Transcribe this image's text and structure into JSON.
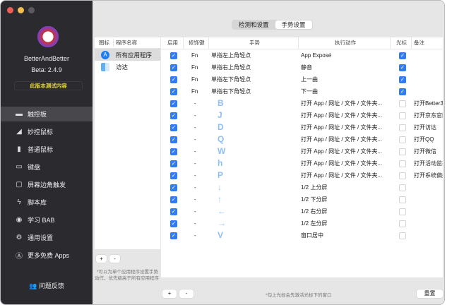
{
  "sidebar": {
    "app_name": "BetterAndBetter",
    "version": "Beta: 2.4.9",
    "test_content": "此版本测试内容",
    "items": [
      {
        "label": "触控板",
        "icon": "trackpad-icon"
      },
      {
        "label": "妙控鼠标",
        "icon": "magic-mouse-icon"
      },
      {
        "label": "普通鼠标",
        "icon": "mouse-icon"
      },
      {
        "label": "键盘",
        "icon": "keyboard-icon"
      },
      {
        "label": "屏幕边角触发",
        "icon": "screen-corner-icon"
      },
      {
        "label": "脚本库",
        "icon": "script-icon"
      },
      {
        "label": "学习 BAB",
        "icon": "disc-icon"
      },
      {
        "label": "通用设置",
        "icon": "gear-icon"
      },
      {
        "label": "更多免费 Apps",
        "icon": "app-store-icon"
      }
    ],
    "feedback": "问题反馈"
  },
  "tabs": [
    {
      "label": "检测和设置",
      "active": false
    },
    {
      "label": "手势设置",
      "active": true
    }
  ],
  "apps": {
    "headers": [
      "图标",
      "程序名称"
    ],
    "rows": [
      {
        "name": "所有应用程序",
        "selected": true
      },
      {
        "name": "访达",
        "selected": false
      }
    ],
    "add": "+",
    "remove": "-",
    "note1": "*可以为单个应用程序设置手势",
    "note2": "动作，优先级高于所有应用程序"
  },
  "table": {
    "headers": [
      "启用",
      "修饰键",
      "手势",
      "执行动作",
      "光标",
      "备注"
    ],
    "rows": [
      {
        "enabled": true,
        "mod": "Fn",
        "gesture": "单指左上角轻点",
        "action": "App Exposé",
        "cursor": true,
        "note": ""
      },
      {
        "enabled": true,
        "mod": "Fn",
        "gesture": "单指右上角轻点",
        "action": "静音",
        "cursor": true,
        "note": ""
      },
      {
        "enabled": true,
        "mod": "Fn",
        "gesture": "单指左下角轻点",
        "action": "上一曲",
        "cursor": true,
        "note": ""
      },
      {
        "enabled": true,
        "mod": "Fn",
        "gesture": "单指右下角轻点",
        "action": "下一曲",
        "cursor": true,
        "note": ""
      },
      {
        "enabled": true,
        "mod": "-",
        "gesture": "B",
        "action": "打开 App / 网址 / 文件 / 文件夹...",
        "cursor": false,
        "note": "打开Better3"
      },
      {
        "enabled": true,
        "mod": "-",
        "gesture": "J",
        "action": "打开 App / 网址 / 文件 / 文件夹...",
        "cursor": false,
        "note": "打开京东官网"
      },
      {
        "enabled": true,
        "mod": "-",
        "gesture": "D",
        "action": "打开 App / 网址 / 文件 / 文件夹...",
        "cursor": false,
        "note": "打开访达"
      },
      {
        "enabled": true,
        "mod": "-",
        "gesture": "Q",
        "action": "打开 App / 网址 / 文件 / 文件夹...",
        "cursor": false,
        "note": "打开QQ"
      },
      {
        "enabled": true,
        "mod": "-",
        "gesture": "W",
        "action": "打开 App / 网址 / 文件 / 文件夹...",
        "cursor": false,
        "note": "打开微信"
      },
      {
        "enabled": true,
        "mod": "-",
        "gesture": "h",
        "action": "打开 App / 网址 / 文件 / 文件夹...",
        "cursor": false,
        "note": "打开活动监视"
      },
      {
        "enabled": true,
        "mod": "-",
        "gesture": "P",
        "action": "打开 App / 网址 / 文件 / 文件夹...",
        "cursor": false,
        "note": "打开系统偏好"
      },
      {
        "enabled": true,
        "mod": "-",
        "gesture": "↓",
        "action": "1/2 上分屏",
        "cursor": false,
        "note": ""
      },
      {
        "enabled": true,
        "mod": "-",
        "gesture": "↑",
        "action": "1/2 下分屏",
        "cursor": false,
        "note": ""
      },
      {
        "enabled": true,
        "mod": "-",
        "gesture": "←",
        "action": "1/2 右分屏",
        "cursor": false,
        "note": ""
      },
      {
        "enabled": true,
        "mod": "-",
        "gesture": "→",
        "action": "1/2 左分屏",
        "cursor": false,
        "note": ""
      },
      {
        "enabled": true,
        "mod": "-",
        "gesture": "V",
        "action": "窗口居中",
        "cursor": false,
        "note": ""
      }
    ],
    "add": "+",
    "remove": "-",
    "cursor_note": "*勾上光标会先激活光标下的窗口",
    "reset": "重置"
  }
}
